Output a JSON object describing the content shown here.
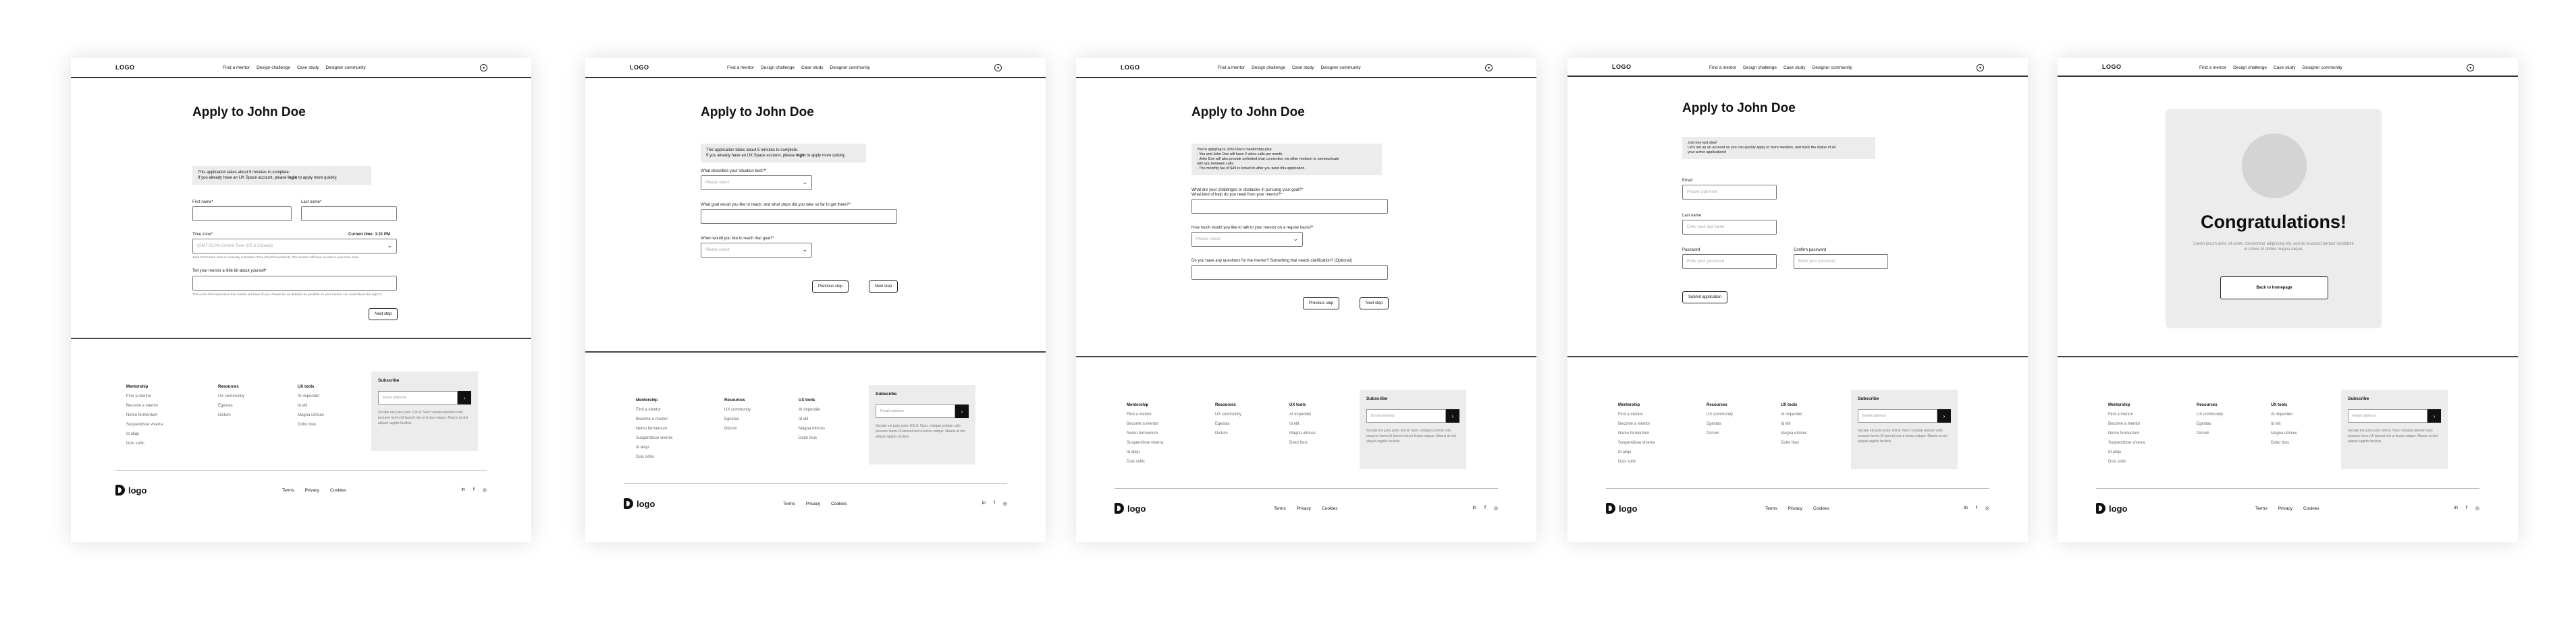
{
  "nav": {
    "logo": "LOGO",
    "links": [
      "Find a mentor",
      "Design challenge",
      "Case study",
      "Designer community"
    ]
  },
  "footer": {
    "col1": {
      "heading": "Mentorship",
      "items": [
        "Find a mentor",
        "Become a mentor",
        "Nemo fermentum",
        "Suspendisse viverra",
        "Id aliqu",
        "Duis sollic"
      ]
    },
    "col2": {
      "heading": "Resources",
      "items": [
        "UX community",
        "Egestas",
        "Dictum"
      ]
    },
    "col3": {
      "heading": "UX tools",
      "items": [
        "At imperdiet",
        "Id elit",
        "Magna ultrices",
        "Dolor ibus"
      ]
    },
    "subscribe": {
      "heading": "Subscribe",
      "placeholder": "Email address",
      "go": "›",
      "desc": "Sociale est justo justo. Elit id. Nunc volutpat pretium odio posuere lorem.Ut laoreet nisi ut lectus natque. Mauris at nisl aliquet sagittis facilisis."
    },
    "brand": "logo",
    "links": [
      "Terms",
      "Privacy",
      "Cookies"
    ],
    "social": [
      "in",
      "f",
      "◎"
    ]
  },
  "s1": {
    "title": "Apply to John Doe",
    "info1": "This application takes about 5 minutes to complete.",
    "info2a": "If you already have an UX Space account, please ",
    "info2b": "login",
    "info2c": " to apply more quickly.",
    "first": "First name*",
    "last": "Last name*",
    "tz": "Time zone*",
    "tz_current": "Current time: 1:21 PM",
    "tz_value": "(GMT-05:00) Central Time (US & Canada)",
    "tz_hint": "John Doe's time zone is currently in Eastern Time (Pacific/Auckland). The mentor will have access to your time zone.",
    "intro": "Tell your mentor a little bit about yourself*",
    "intro_hint": "This is the first impression this mentor will have of you. Please be as detailed as possible so your mentor can understand the right fit.",
    "next": "Next step"
  },
  "s2": {
    "title": "Apply to John Doe",
    "info1": "This application takes about 5 minutes to complete.",
    "info2a": "If you already have an UX Space account, please ",
    "info2b": "login",
    "info2c": " to apply more quickly.",
    "q1": "What describes your situation best?*",
    "q1_ph": "Please select",
    "q2": "What goal would you like to reach, and what steps did you take so far to get there?*",
    "q3": "When would you like to reach that goal?*",
    "q3_ph": "Please select",
    "prev": "Previous step",
    "next": "Next step"
  },
  "s3": {
    "title": "Apply to John Doe",
    "info": [
      "You're applying to John Doe's mentorship plan.",
      "- You and John Doe will have 2 video calls per month.",
      "- John Doe will also provide unlimited chat connection via other medium to communicate",
      "  with you between calls.",
      "- The monthly fee of $49 is locked in after you send this application."
    ],
    "q1": "What are your challenges or obstacles in pursuing your goal?*",
    "q1b": "What kind of help do you need from your mentor?*",
    "q2": "How much would you like to talk to your mentor on a regular basis?*",
    "q2_ph": "Please select",
    "q3": "Do you have any questions for the mentor? Something that needs clarification? (Optional)",
    "prev": "Previous step",
    "next": "Next step"
  },
  "s4": {
    "title": "Apply to John Doe",
    "info": [
      "Just one last step!",
      "Let's set up an account so you can quickly apply to more mentors, and track the status of all",
      "your active applications!"
    ],
    "email": "Email",
    "email_ph": "Please type here",
    "lastname": "Last name",
    "lastname_ph": "Enter your last name",
    "password": "Password",
    "password_ph": "Enter your password",
    "confirm": "Confirm password",
    "confirm_ph": "Enter your password",
    "submit": "Submit application"
  },
  "s5": {
    "title": "Congratulations!",
    "text": "Lorem ipsum dolor sit amet, consectetur adipiscing elit, sed do eiusmod tempor incididunt ut labore et dolore magna aliqua.",
    "back": "Back to homepage"
  }
}
